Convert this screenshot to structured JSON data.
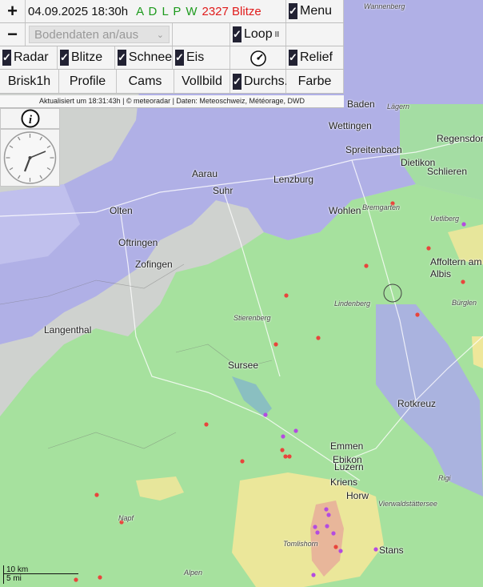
{
  "header": {
    "zoom_in": "+",
    "zoom_out": "−",
    "datetime": "04.09.2025 18:30h",
    "sources": "A D L P W",
    "lightning_count": "2327 Blitze",
    "menu": "Menu",
    "ground_data": "Bodendaten an/aus",
    "loop": "Loop",
    "loop_symbol": "II"
  },
  "toggles": [
    {
      "label": "Radar",
      "checked": true
    },
    {
      "label": "Blitze",
      "checked": true
    },
    {
      "label": "Schnee",
      "checked": true
    },
    {
      "label": "Eis",
      "checked": true
    },
    {
      "label": "Relief",
      "checked": true
    }
  ],
  "buttons": [
    "Brisk1h",
    "Profile",
    "Cams",
    "Vollbild",
    "Durchs.",
    "Farbe"
  ],
  "credits": "Aktualisiert um 18:31:43h | © meteoradar | Daten: Meteoschweiz, Météorage, DWD",
  "info_icon": "info-icon",
  "scale": {
    "km": "10 km",
    "mi": "5 mi"
  },
  "map_labels": [
    {
      "text": "Wannenberg",
      "cls": "it"
    },
    {
      "text": "Baden",
      "cls": "big"
    },
    {
      "text": "Lägern",
      "cls": "it"
    },
    {
      "text": "Wettingen",
      "cls": "big"
    },
    {
      "text": "Regensdorf",
      "cls": "big"
    },
    {
      "text": "Spreitenbach",
      "cls": "big"
    },
    {
      "text": "Dietikon",
      "cls": "big"
    },
    {
      "text": "Schlieren",
      "cls": "big"
    },
    {
      "text": "Aarau",
      "cls": "big"
    },
    {
      "text": "Lenzburg",
      "cls": "big"
    },
    {
      "text": "Suhr",
      "cls": "big"
    },
    {
      "text": "Wohlen",
      "cls": "big"
    },
    {
      "text": "Bremgarten",
      "cls": "it"
    },
    {
      "text": "Olten",
      "cls": "big"
    },
    {
      "text": "Oftringen",
      "cls": "big"
    },
    {
      "text": "Zofingen",
      "cls": "big"
    },
    {
      "text": "Uetliberg",
      "cls": "it"
    },
    {
      "text": "Affoltern am",
      "cls": "big"
    },
    {
      "text": "Albis",
      "cls": "big"
    },
    {
      "text": "Lindenberg",
      "cls": "it"
    },
    {
      "text": "Bürglen",
      "cls": "it"
    },
    {
      "text": "Langenthal",
      "cls": "big"
    },
    {
      "text": "Stierenberg",
      "cls": "it"
    },
    {
      "text": "Sursee",
      "cls": "big"
    },
    {
      "text": "Rotkreuz",
      "cls": "big"
    },
    {
      "text": "Emmen",
      "cls": "big"
    },
    {
      "text": "Ebikon",
      "cls": "big"
    },
    {
      "text": "Luzern",
      "cls": "big"
    },
    {
      "text": "Kriens",
      "cls": "big"
    },
    {
      "text": "Horw",
      "cls": "big"
    },
    {
      "text": "Rigi",
      "cls": "it"
    },
    {
      "text": "Napf",
      "cls": "it"
    },
    {
      "text": "Tomlishorn",
      "cls": "it"
    },
    {
      "text": "Stans",
      "cls": "big"
    },
    {
      "text": "Alpen",
      "cls": "it"
    },
    {
      "text": "Vierwaldstättersee",
      "cls": "it"
    }
  ],
  "colors": {
    "green": "#a3e29b",
    "blue": "#a9a9ea",
    "yellow": "#eee79a",
    "lightning": "#e8453c",
    "lightning_recent": "#b44be0",
    "sources_color": "#1d9a1d",
    "count_color": "#e01b1b"
  }
}
